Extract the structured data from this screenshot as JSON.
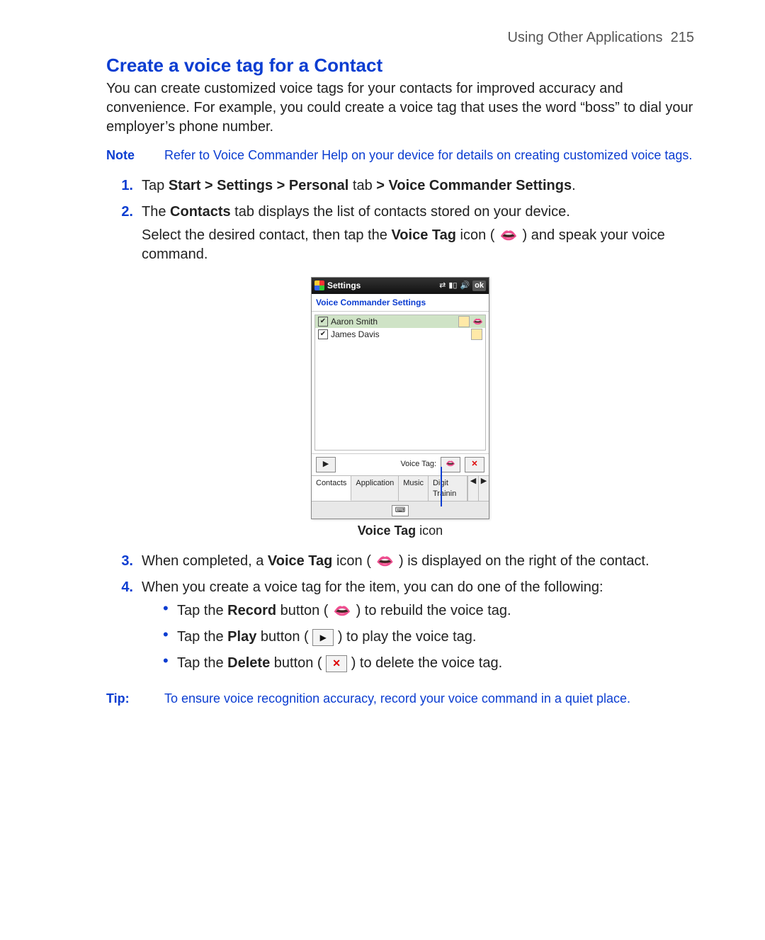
{
  "header": {
    "section": "Using Other Applications",
    "page": "215"
  },
  "title": "Create a voice tag for a Contact",
  "intro": "You can create customized voice tags for your contacts for improved accuracy and convenience.  For  example, you could create a voice tag that uses the word “boss” to dial your employer’s phone number.",
  "note": {
    "label": "Note",
    "text": "Refer to  Voice Commander Help on your device for details on creating customized voice tags."
  },
  "steps": {
    "s1": {
      "num": "1.",
      "pre": "Tap ",
      "b1": "Start > Settings > Personal",
      "mid": " tab ",
      "b2": "> Voice Commander Settings",
      "post": "."
    },
    "s2": {
      "num": "2.",
      "line1_pre": "The ",
      "line1_b": "Contacts",
      "line1_post": " tab displays the list of contacts stored on your device.",
      "line2_pre": "Select the desired contact, then tap the ",
      "line2_b": "Voice Tag",
      "line2_mid": " icon ( ",
      "line2_post": " ) and speak your voice command."
    },
    "s3": {
      "num": "3.",
      "pre": "When completed, a ",
      "b": "Voice Tag",
      "mid": " icon ( ",
      "post": " ) is displayed on the right of the contact."
    },
    "s4": {
      "num": "4.",
      "text": "When you create a voice tag for the item, you can do one of the following:"
    }
  },
  "bullets": {
    "b1": {
      "pre": "Tap the ",
      "b": "Record",
      "mid": " button ( ",
      "post": " ) to rebuild the voice tag."
    },
    "b2": {
      "pre": "Tap the ",
      "b": "Play",
      "mid": " button ( ",
      "post": " ) to play the voice tag."
    },
    "b3": {
      "pre": "Tap the ",
      "b": "Delete",
      "mid": " button ( ",
      "post": " ) to delete the voice tag."
    }
  },
  "tip": {
    "label": "Tip:",
    "text": "To ensure voice recognition accuracy, record your voice command in a quiet place."
  },
  "device": {
    "titlebar": {
      "title": "Settings",
      "ok": "ok"
    },
    "subheader": "Voice Commander Settings",
    "rows": [
      {
        "name": "Aaron Smith",
        "selected": true,
        "hasCard": true,
        "hasTag": true
      },
      {
        "name": "James Davis",
        "selected": false,
        "hasCard": true,
        "hasTag": false
      }
    ],
    "toolbar": {
      "voice_tag_label": "Voice Tag:"
    },
    "tabs": [
      "Contacts",
      "Application",
      "Music",
      "Digit Trainin"
    ],
    "caption_b": "Voice Tag",
    "caption_post": " icon"
  }
}
